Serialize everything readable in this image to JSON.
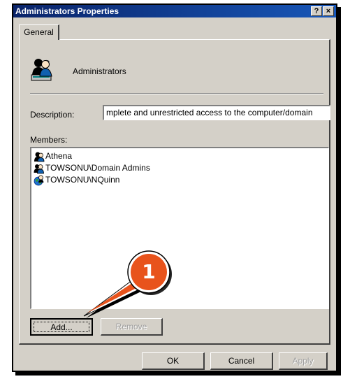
{
  "window": {
    "title": "Administrators Properties",
    "help_glyph": "?",
    "close_glyph": "×"
  },
  "tabs": [
    {
      "label": "General"
    }
  ],
  "group": {
    "name": "Administrators",
    "icon": "user-group-icon"
  },
  "description": {
    "label": "Description:",
    "value": "mplete and unrestricted access to the computer/domain"
  },
  "members": {
    "label": "Members:",
    "items": [
      {
        "name": "Athena",
        "icon": "local-user-icon"
      },
      {
        "name": "TOWSONU\\Domain Admins",
        "icon": "domain-group-icon"
      },
      {
        "name": "TOWSONU\\NQuinn",
        "icon": "domain-user-icon"
      }
    ]
  },
  "buttons": {
    "add": "Add...",
    "remove": "Remove",
    "ok": "OK",
    "cancel": "Cancel",
    "apply": "Apply"
  },
  "callout": {
    "number": "1",
    "color": "#e8531c"
  },
  "colors": {
    "titlebar": "#0a246a",
    "dialog_face": "#d4d0c8"
  }
}
